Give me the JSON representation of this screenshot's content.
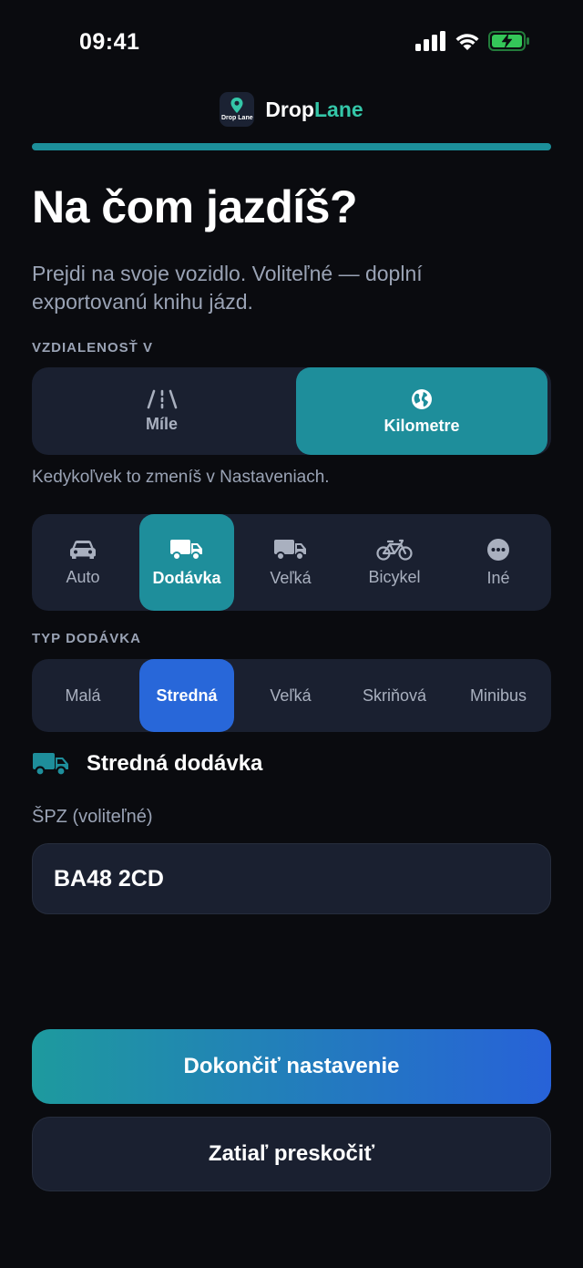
{
  "status_bar": {
    "time": "09:41",
    "icons": [
      "signal-icon",
      "wifi-icon",
      "battery-charging-icon"
    ],
    "battery_color": "#34c759"
  },
  "brand": {
    "logo_text": "Drop Lane",
    "name_part1": "Drop",
    "name_part2": "Lane",
    "accent_color": "#34c6a8"
  },
  "progress": {
    "fraction": 1.0,
    "color": "#1c8f9a"
  },
  "page": {
    "title": "Na čom jazdíš?",
    "subtitle": "Prejdi na svoje vozidlo. Voliteľné — doplní exportovanú knihu jázd."
  },
  "distance": {
    "label": "VZDIALENOSŤ V",
    "options": [
      {
        "label": "Míle",
        "icon": "road-icon",
        "selected": false
      },
      {
        "label": "Kilometre",
        "icon": "globe-icon",
        "selected": true
      }
    ],
    "hint": "Kedykoľvek to zmeníš v Nastaveniach."
  },
  "vehicles": {
    "options": [
      {
        "label": "Auto",
        "icon": "car-icon",
        "selected": false
      },
      {
        "label": "Dodávka",
        "icon": "van-icon",
        "selected": true
      },
      {
        "label": "Veľká",
        "icon": "truck-icon",
        "selected": false
      },
      {
        "label": "Bicykel",
        "icon": "bicycle-icon",
        "selected": false
      },
      {
        "label": "Iné",
        "icon": "more-icon",
        "selected": false
      }
    ]
  },
  "van_type": {
    "label": "TYP DODÁVKA",
    "options": [
      {
        "label": "Malá",
        "selected": false
      },
      {
        "label": "Stredná",
        "selected": true
      },
      {
        "label": "Veľká",
        "selected": false
      },
      {
        "label": "Skriňová",
        "selected": false
      },
      {
        "label": "Minibus",
        "selected": false
      }
    ]
  },
  "selected_vehicle": {
    "name": "Stredná dodávka",
    "icon": "van-icon"
  },
  "plate": {
    "label": "ŠPZ (voliteľné)",
    "value": "BA48 2CD"
  },
  "actions": {
    "primary": "Dokončiť nastavenie",
    "secondary": "Zatiaľ preskočiť"
  },
  "colors": {
    "background": "#0a0b0f",
    "panel": "#1a2030",
    "teal": "#1e8e9b",
    "blue": "#2867d9",
    "muted_text": "#9aa3b5"
  }
}
